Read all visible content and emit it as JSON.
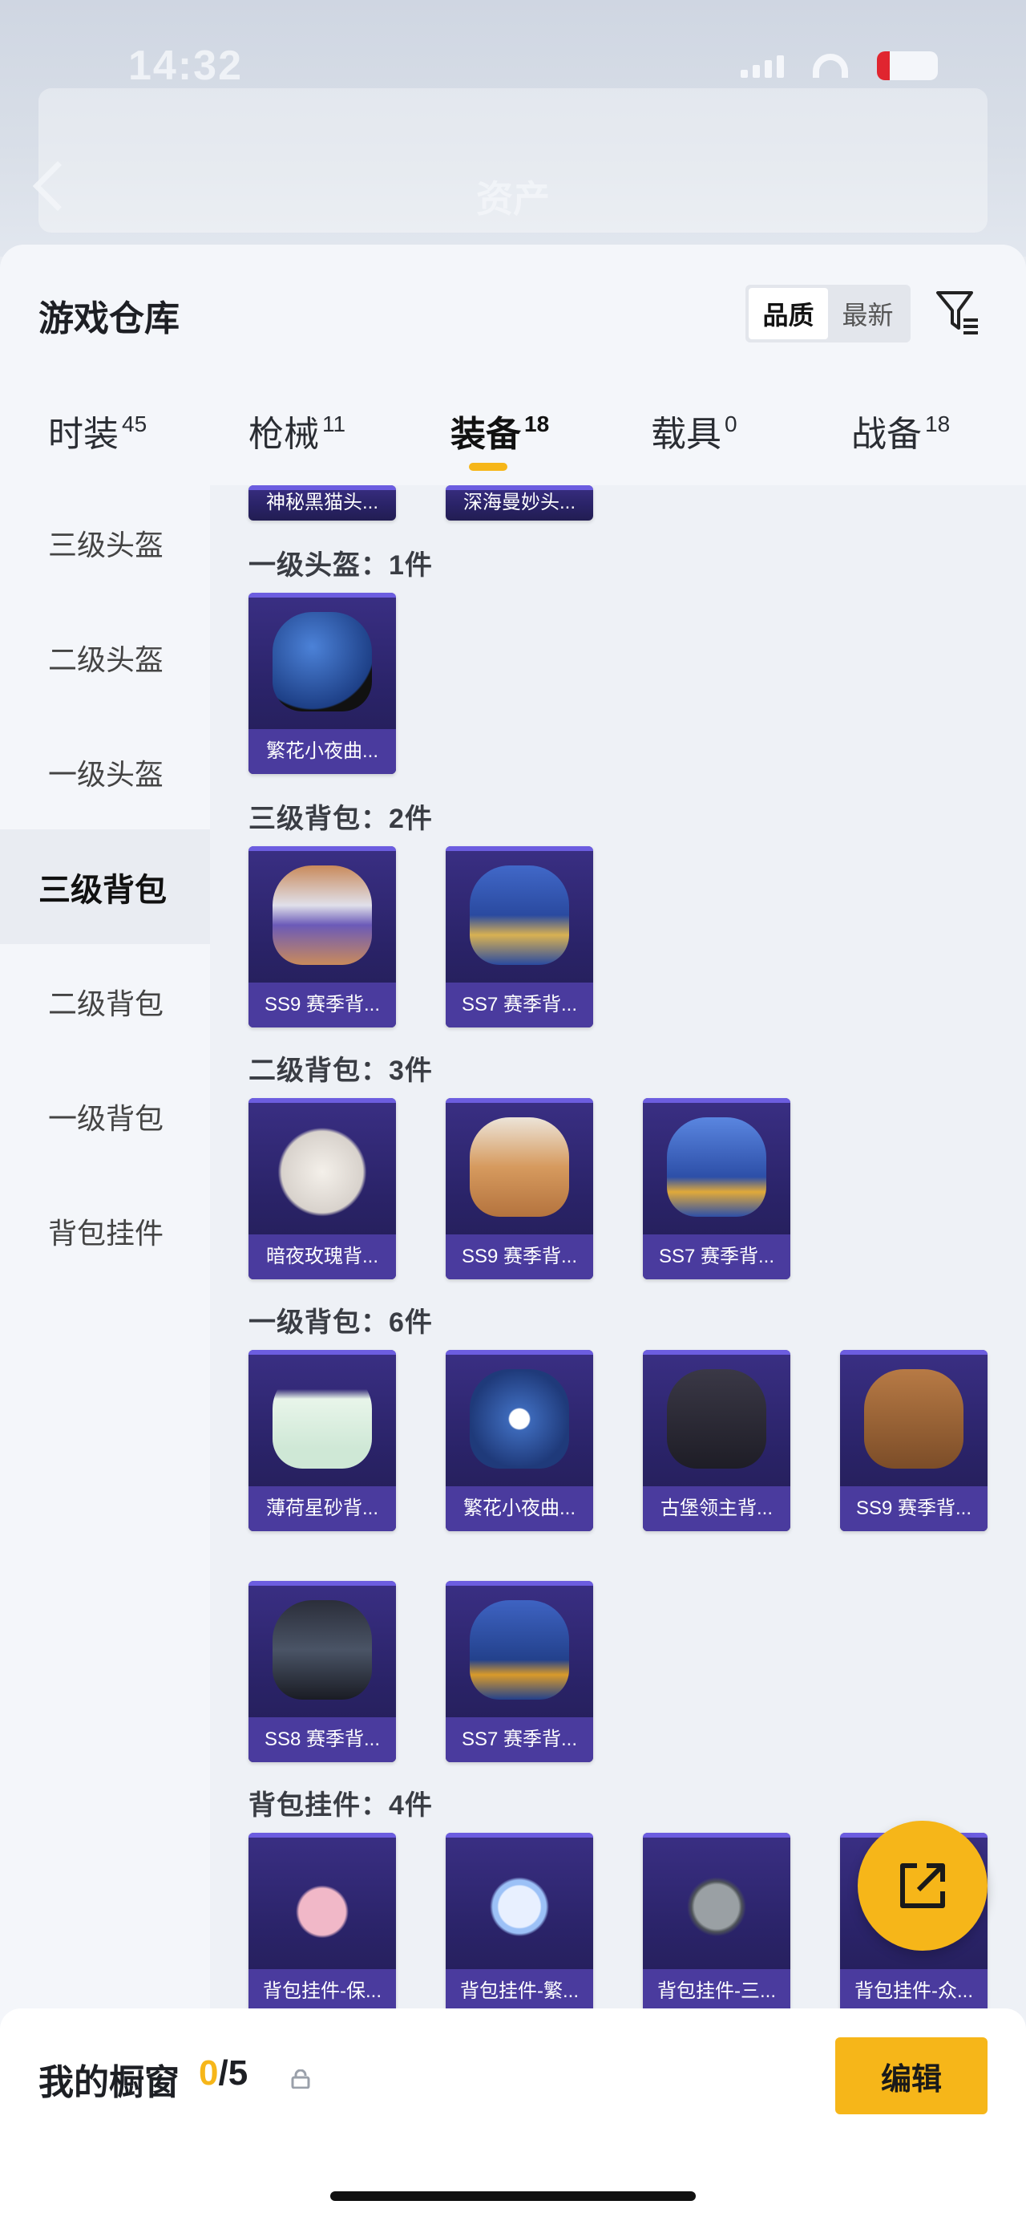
{
  "status": {
    "time": "14:32"
  },
  "header": {
    "title": "资产"
  },
  "warehouse": {
    "title": "游戏仓库",
    "sort": [
      "品质",
      "最新"
    ],
    "sort_active": "品质"
  },
  "tabs": [
    {
      "label": "时装",
      "count": "45"
    },
    {
      "label": "枪械",
      "count": "11"
    },
    {
      "label": "装备",
      "count": "18",
      "active": true
    },
    {
      "label": "载具",
      "count": "0"
    },
    {
      "label": "战备",
      "count": "18"
    }
  ],
  "side_menu": [
    "三级头盔",
    "二级头盔",
    "一级头盔",
    "三级背包",
    "二级背包",
    "一级背包",
    "背包挂件"
  ],
  "side_active": "三级背包",
  "sections": {
    "top_partial": [
      "神秘黑猫头...",
      "深海曼妙头..."
    ],
    "helmet1": {
      "title": "一级头盔：1件",
      "items": [
        "繁花小夜曲..."
      ]
    },
    "bag3": {
      "title": "三级背包：2件",
      "items": [
        "SS9 赛季背...",
        "SS7 赛季背..."
      ]
    },
    "bag2": {
      "title": "二级背包：3件",
      "items": [
        "暗夜玫瑰背...",
        "SS9 赛季背...",
        "SS7 赛季背..."
      ]
    },
    "bag1": {
      "title": "一级背包：6件",
      "items": [
        "薄荷星砂背...",
        "繁花小夜曲...",
        "古堡领主背...",
        "SS9 赛季背...",
        "SS8 赛季背...",
        "SS7 赛季背..."
      ]
    },
    "charm": {
      "title": "背包挂件：4件",
      "items": [
        "背包挂件-保...",
        "背包挂件-繁...",
        "背包挂件-三...",
        "背包挂件-众..."
      ]
    }
  },
  "bottom": {
    "title": "我的橱窗",
    "current": "0",
    "total": "/5",
    "edit_label": "编辑"
  },
  "colors": {
    "accent": "#f6b619",
    "card_bg": "#2a2368"
  }
}
